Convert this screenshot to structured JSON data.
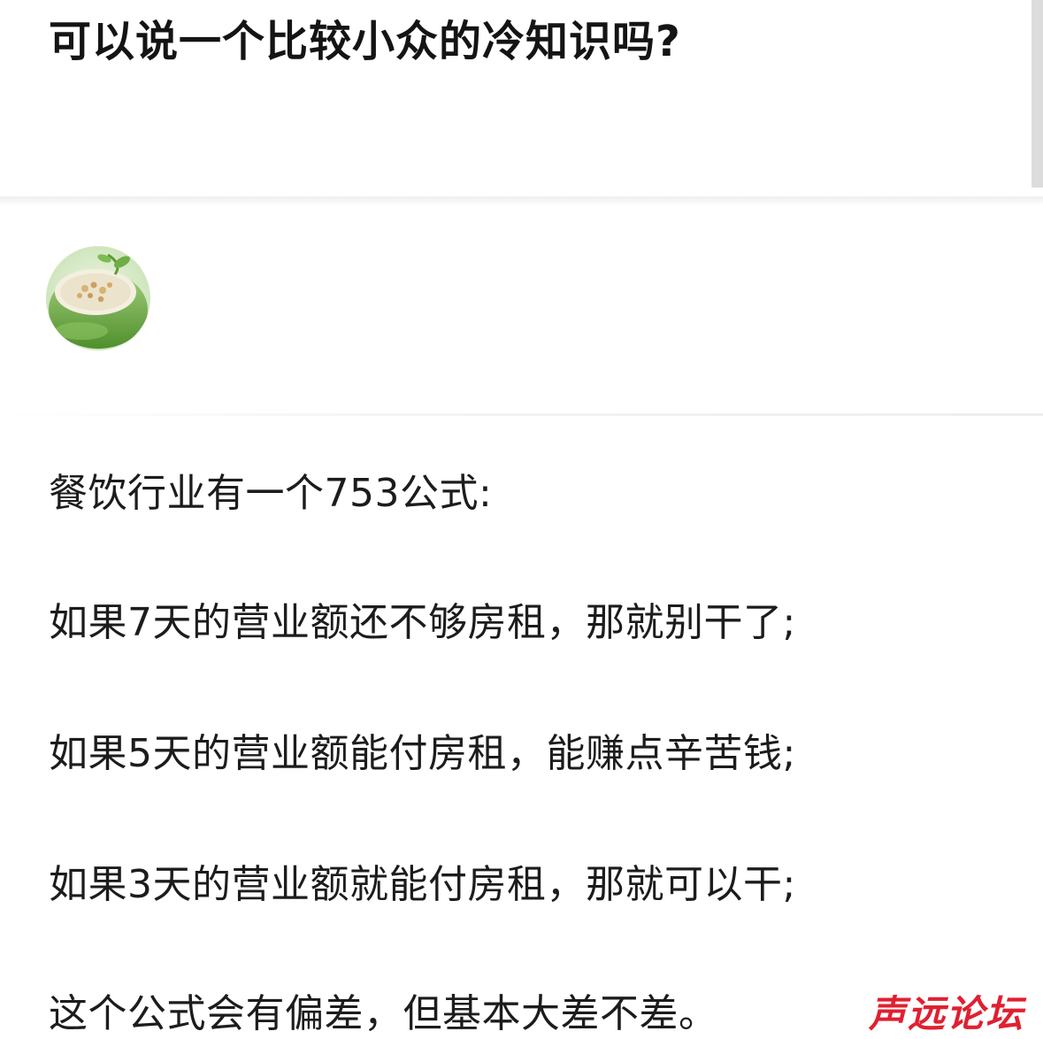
{
  "question": {
    "title": "可以说一个比较小众的冷知识吗?"
  },
  "author": {
    "avatar_icon": "bowl-of-porridge-avatar"
  },
  "answer": {
    "paragraphs": [
      "餐饮行业有一个753公式:",
      "如果7天的营业额还不够房租，那就别干了;",
      "如果5天的营业额能付房租，能赚点辛苦钱;",
      "如果3天的营业额就能付房租，那就可以干;",
      "这个公式会有偏差，但基本大差不差。"
    ]
  },
  "watermark": {
    "text": "声远论坛",
    "color": "#e02030"
  },
  "colors": {
    "text": "#1c1c1c",
    "title": "#141414",
    "divider": "#efefef",
    "scrollbar": "#dcdcdc"
  }
}
